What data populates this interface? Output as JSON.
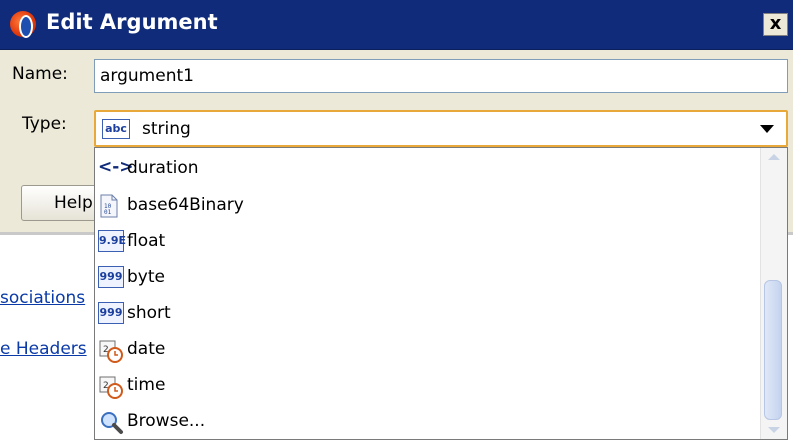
{
  "dialog": {
    "title": "Edit Argument",
    "close_label": "x"
  },
  "form": {
    "name_label": "Name:",
    "name_value": "argument1",
    "type_label": "Type:",
    "type_value": "string",
    "type_icon": "abc",
    "help_label": "Help"
  },
  "dropdown": {
    "items": [
      {
        "label": "duration",
        "icon": "duration-icon",
        "icon_text": "<->"
      },
      {
        "label": "base64Binary",
        "icon": "binary-icon",
        "icon_text": "101"
      },
      {
        "label": "float",
        "icon": "float-icon",
        "icon_text": "9.9E"
      },
      {
        "label": "byte",
        "icon": "number-icon",
        "icon_text": "999"
      },
      {
        "label": "short",
        "icon": "number-icon",
        "icon_text": "999"
      },
      {
        "label": "date",
        "icon": "date-icon",
        "icon_text": ""
      },
      {
        "label": "time",
        "icon": "time-icon",
        "icon_text": ""
      },
      {
        "label": "Browse...",
        "icon": "search-icon",
        "icon_text": ""
      }
    ]
  },
  "background": {
    "link_1": "sociations",
    "link_2": "e Headers"
  },
  "colors": {
    "titlebar": "#0f2b7a",
    "focus_border": "#e8a93a",
    "link": "#0a3aa7"
  }
}
